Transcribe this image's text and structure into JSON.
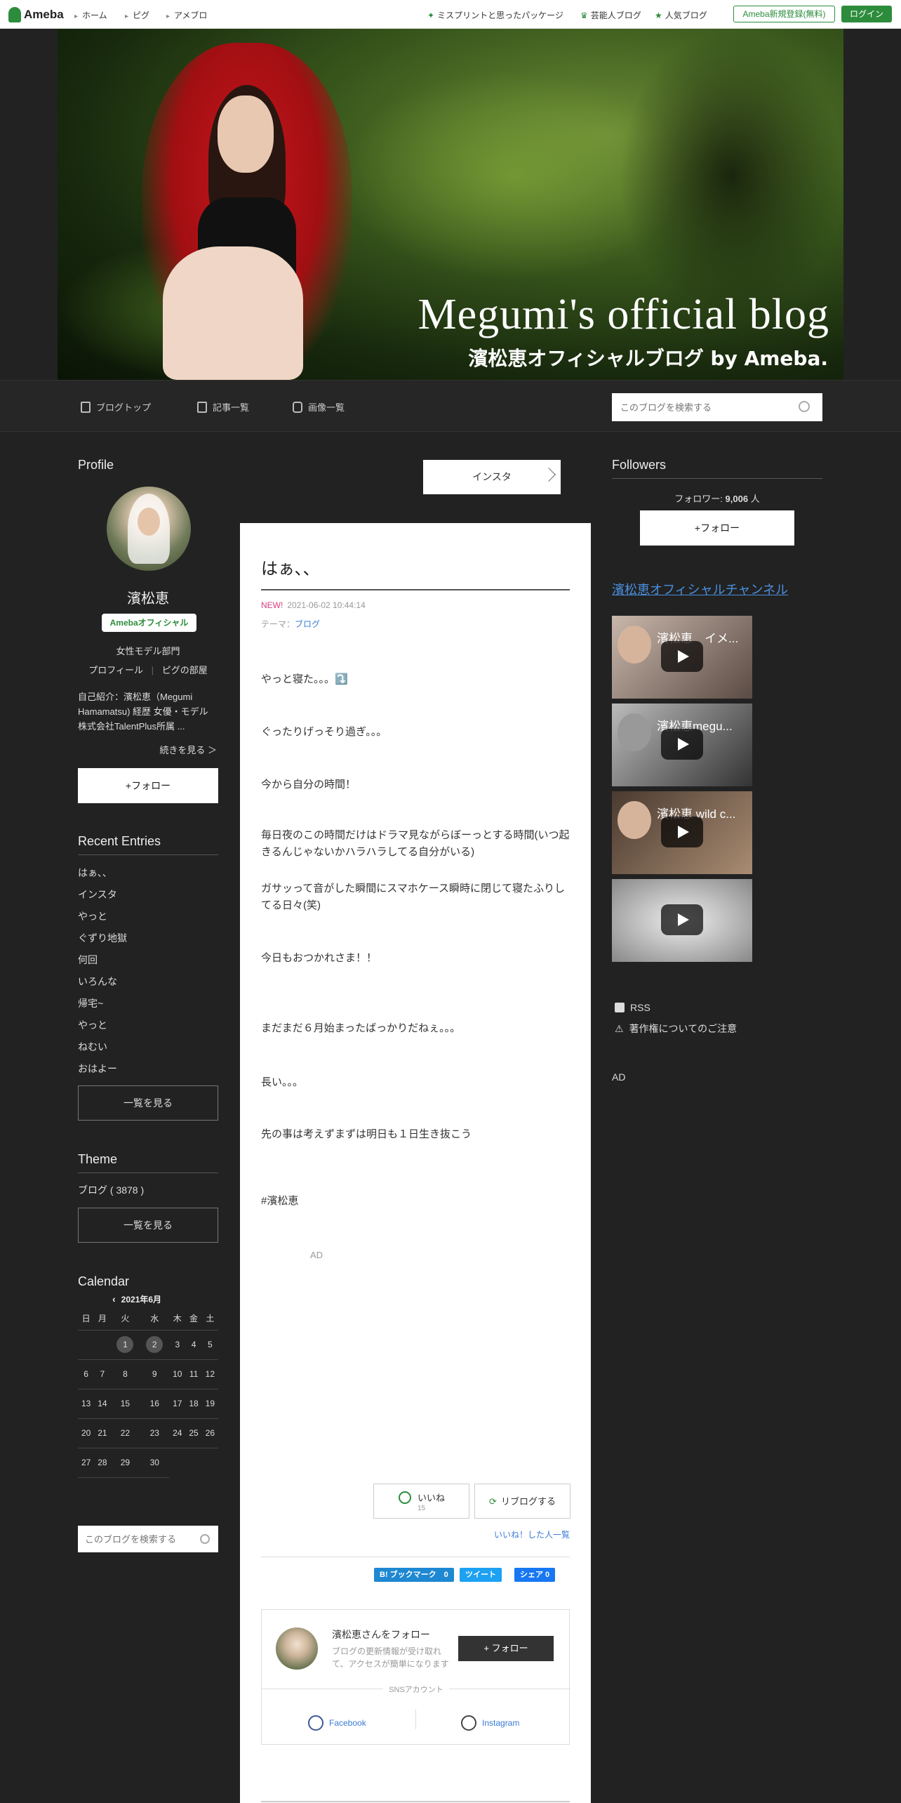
{
  "topbar": {
    "logo": "Ameba",
    "nav": [
      "ホーム",
      "ピグ",
      "アメブロ"
    ],
    "right_links": [
      "ミスプリントと思ったパッケージ",
      "芸能人ブログ",
      "人気ブログ"
    ],
    "signup": "Ameba新規登録(無料)",
    "login": "ログイン"
  },
  "hero": {
    "title_en": "Megumi's official blog",
    "title_ja": "濱松恵オフィシャルブログ by Ameba."
  },
  "blognav": {
    "items": [
      "ブログトップ",
      "記事一覧",
      "画像一覧"
    ],
    "search_placeholder": "このブログを検索する"
  },
  "profile": {
    "heading": "Profile",
    "name": "濱松恵",
    "badge": "Amebaオフィシャル",
    "category": "女性モデル部門",
    "link_profile": "プロフィール",
    "link_pig": "ピグの部屋",
    "intro": "自己紹介：濱松恵（Megumi Hamamatsu) 経歴 女優・モデル 株式会社TalentPlus所属 ...",
    "read_more": "続きを見る ＞",
    "follow": "+フォロー"
  },
  "recent": {
    "heading": "Recent Entries",
    "items": [
      "はぁ、、",
      "インスタ",
      "やっと",
      "ぐずり地獄",
      "何回",
      "いろんな",
      "帰宅~",
      "やっと",
      "ねむい",
      "おはよー"
    ],
    "see_all": "一覧を見る"
  },
  "theme": {
    "heading": "Theme",
    "item": "ブログ ( 3878 )",
    "see_all": "一覧を見る"
  },
  "calendar": {
    "heading": "Calendar",
    "month": "2021年6月",
    "weekdays": [
      "日",
      "月",
      "火",
      "水",
      "木",
      "金",
      "土"
    ],
    "weeks": [
      [
        "",
        "",
        "1",
        "2",
        "3",
        "4",
        "5"
      ],
      [
        "6",
        "7",
        "8",
        "9",
        "10",
        "11",
        "12"
      ],
      [
        "13",
        "14",
        "15",
        "16",
        "17",
        "18",
        "19"
      ],
      [
        "20",
        "21",
        "22",
        "23",
        "24",
        "25",
        "26"
      ],
      [
        "27",
        "28",
        "29",
        "30",
        "",
        "",
        ""
      ]
    ],
    "highlighted": [
      "1",
      "2"
    ]
  },
  "bottom_search_placeholder": "このブログを検索する",
  "article": {
    "prev_button": "インスタ",
    "title": "はぁ、、",
    "new_label": "NEW!",
    "datetime": "2021-06-02 10:44:14",
    "theme_label": "テーマ：",
    "theme_value": "ブログ",
    "paragraphs": [
      "やっと寝た。。。⤵️",
      "ぐったりげっそり過ぎ。。。",
      "今から自分の時間！",
      "毎日夜のこの時間だけはドラマ見ながらぼーっとする時間(いつ起きるんじゃないかハラハラしてる自分がいる)",
      "ガサッって音がした瞬間にスマホケース瞬時に閉じて寝たふりしてる日々(笑)",
      "今日もおつかれさま！！",
      "まだまだ６月始まったばっかりだねぇ。。。",
      "長い。。。",
      "先の事は考えずまずは明日も１日生き抜こう"
    ],
    "hashtag": "#濱松恵",
    "ad": "AD",
    "like": "いいね",
    "like_count": "15",
    "reblog": "リブログする",
    "liked_list": "いいね！した人一覧",
    "share": {
      "hatena": "B! ブックマーク　0",
      "tweet": "ツイート",
      "facebook": "シェア 0"
    },
    "follow_card": {
      "name": "濱松恵さんをフォロー",
      "desc": "ブログの更新情報が受け取れて、アクセスが簡単になります",
      "button": "+ フォロー",
      "sns_label": "SNSアカウント",
      "facebook": "Facebook",
      "instagram": "Instagram"
    }
  },
  "right": {
    "followers_heading": "Followers",
    "follower_label": "フォロワー: ",
    "follower_count": "9,006",
    "follower_unit": " 人",
    "follow": "+フォロー",
    "channel": "濱松恵オフィシャルチャンネル",
    "videos": [
      "濱松恵　イメ...",
      "濱松恵megu...",
      "濱松恵 wild c...",
      ""
    ],
    "rss": "RSS",
    "copyright": "著作権についてのご注意",
    "ad": "AD"
  }
}
